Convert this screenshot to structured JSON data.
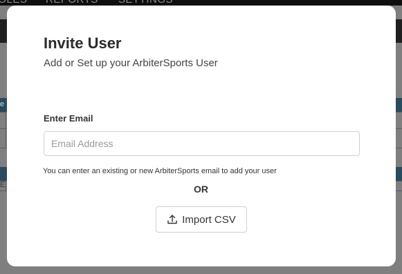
{
  "background": {
    "nav_items": [
      "ROLES",
      "REPORTS",
      "SETTINGS"
    ],
    "header_fragments": [
      "e",
      "E"
    ]
  },
  "modal": {
    "title": "Invite User",
    "subtitle": "Add or Set up your ArbiterSports User",
    "email_label": "Enter Email",
    "email_placeholder": "Email Address",
    "email_value": "",
    "helper_text": "You can enter an existing or new ArbiterSports email to add your user",
    "or_text": "OR",
    "import_button_label": "Import CSV",
    "import_icon": "upload-icon"
  }
}
